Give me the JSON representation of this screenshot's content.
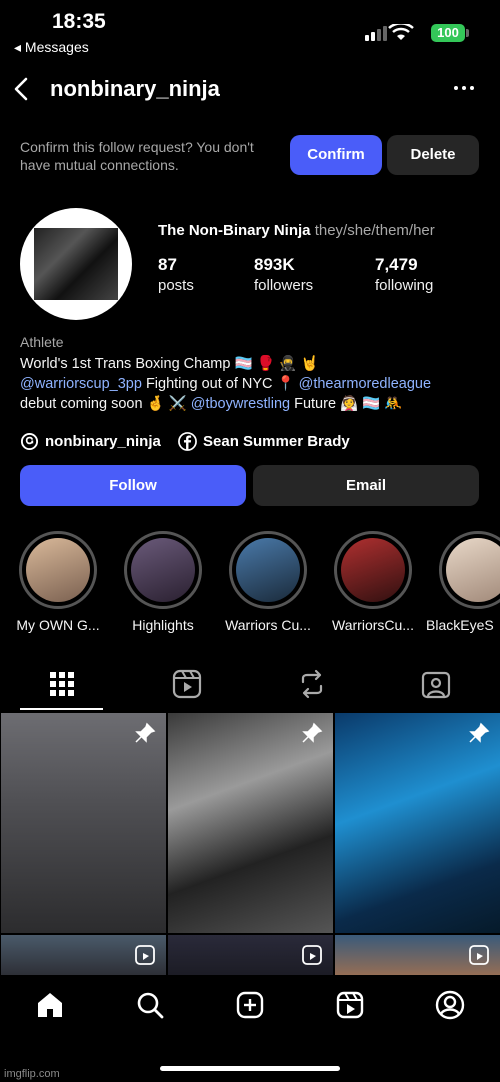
{
  "status_bar": {
    "time": "18:35",
    "back_app": "◂ Messages",
    "battery": "100"
  },
  "header": {
    "username": "nonbinary_ninja"
  },
  "follow_request": {
    "text": "Confirm this follow request? You don't have mutual connections.",
    "confirm_label": "Confirm",
    "delete_label": "Delete"
  },
  "profile": {
    "display_name": "The Non-Binary Ninja",
    "pronouns": "they/she/them/her",
    "stats": [
      {
        "value": "87",
        "label": "posts"
      },
      {
        "value": "893K",
        "label": "followers"
      },
      {
        "value": "7,479",
        "label": "following"
      }
    ],
    "category": "Athlete",
    "bio": {
      "line1": "World's 1st Trans Boxing Champ 🏳️‍⚧️ 🥊 🥷 🤘",
      "line2_link1": "@warriorscup_3pp",
      "line2_text": " Fighting out of NYC 📍 ",
      "line2_link2": "@thearmoredleague",
      "line3_text1": "debut coming soon 🤞 ⚔️ ",
      "line3_link": "@tboywrestling",
      "line3_text2": " Future 👰 🏳️‍⚧️ 🤼"
    },
    "threads_handle": "nonbinary_ninja",
    "facebook_name": "Sean Summer Brady"
  },
  "actions": {
    "follow_label": "Follow",
    "email_label": "Email"
  },
  "highlights": [
    {
      "label": "My OWN G...",
      "color": "#c9a98a"
    },
    {
      "label": "Highlights",
      "color": "#5a4a6a"
    },
    {
      "label": "Warriors Cu...",
      "color": "#3a6a9a"
    },
    {
      "label": "WarriorsCu...",
      "color": "#8a2a2a"
    },
    {
      "label": "BlackEyeS",
      "color": "#d8c8b8"
    }
  ],
  "watermark": "imgflip.com",
  "colors": {
    "accent": "#4a5df9",
    "surface": "#262626",
    "link": "#8fb3ff"
  }
}
